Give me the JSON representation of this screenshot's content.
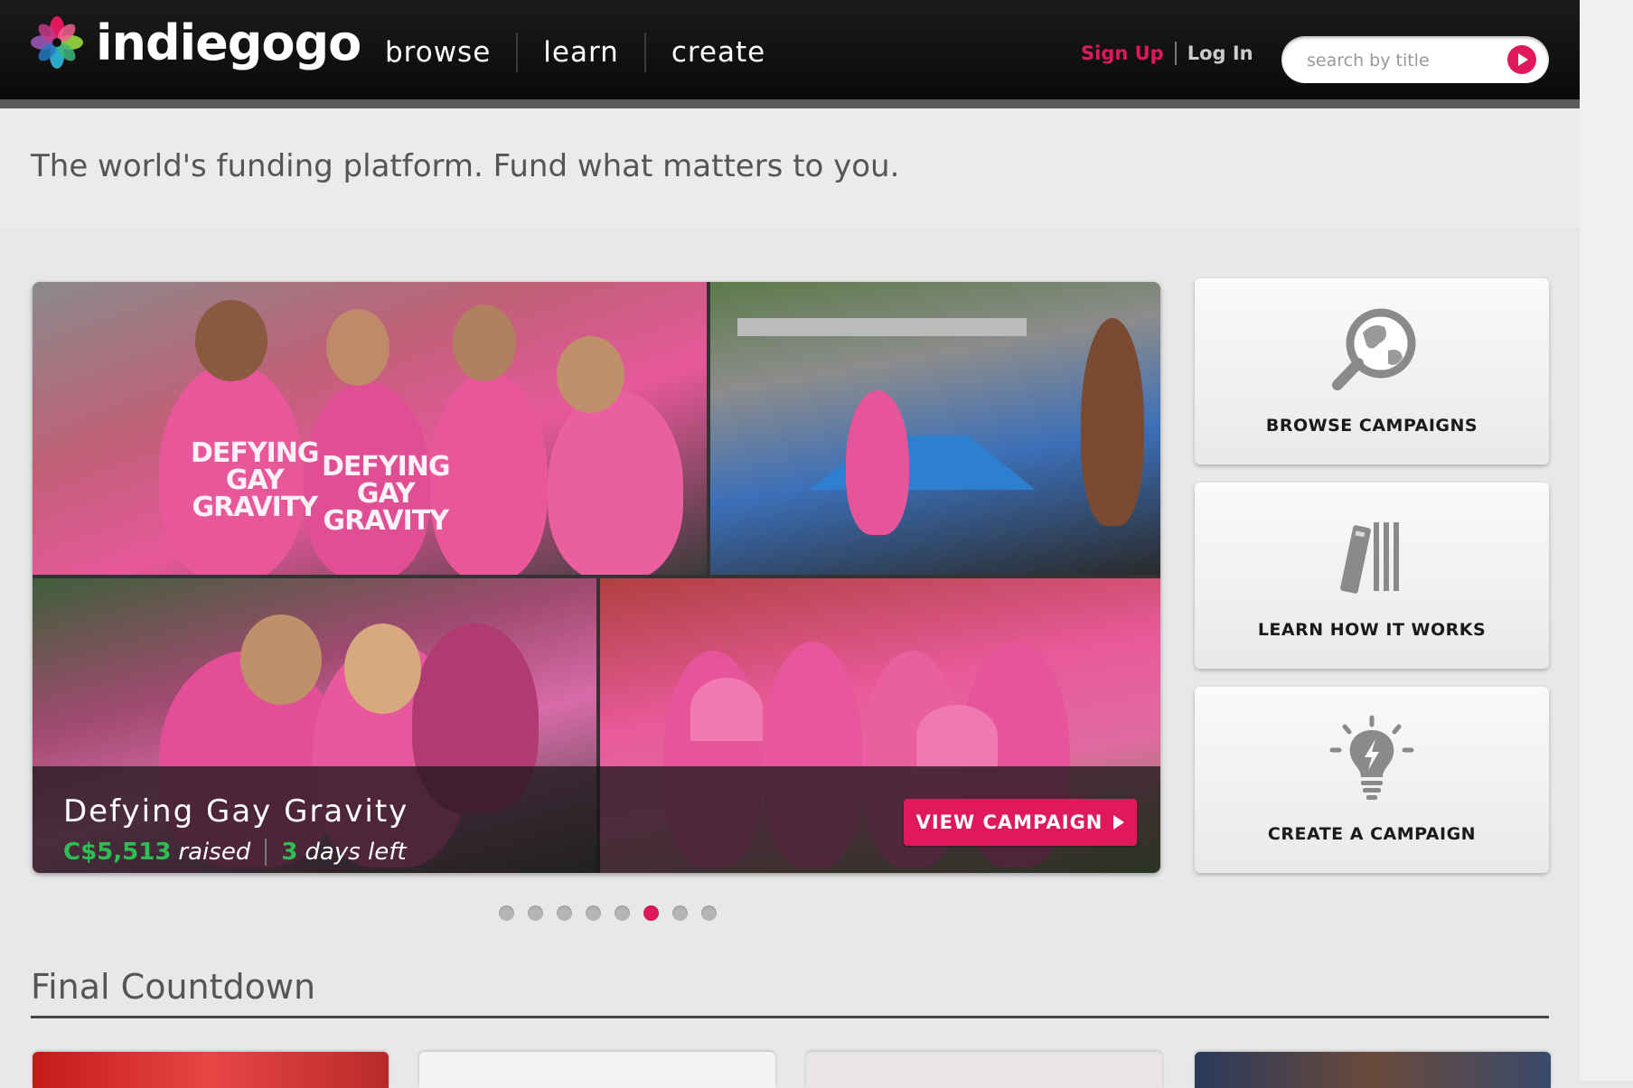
{
  "brand": {
    "name": "indiegogo"
  },
  "nav": {
    "items": [
      "browse",
      "learn",
      "create"
    ]
  },
  "auth": {
    "sign_up": "Sign Up",
    "log_in": "Log In"
  },
  "search": {
    "placeholder": "search by title",
    "value": ""
  },
  "tagline": "The world's funding platform. Fund what matters to you.",
  "hero": {
    "campaign_title": "Defying Gay Gravity",
    "raised_amount": "C$5,513",
    "raised_label": "raised",
    "days_count": "3",
    "days_label": "days left",
    "cta_label": "VIEW CAMPAIGN",
    "shirt_text": [
      "DEFYING",
      "GAY",
      "GRAVITY"
    ]
  },
  "carousel": {
    "total_slides": 8,
    "active_index": 5
  },
  "side_cards": [
    {
      "label": "BROWSE CAMPAIGNS",
      "icon": "globe-search-icon"
    },
    {
      "label": "LEARN HOW IT WORKS",
      "icon": "books-icon"
    },
    {
      "label": "CREATE A CAMPAIGN",
      "icon": "lightbulb-icon"
    }
  ],
  "final_countdown": {
    "title": "Final Countdown"
  },
  "colors": {
    "brand_pink": "#e01a5a",
    "raised_green": "#2fbe54",
    "header_bg": "#111111"
  }
}
